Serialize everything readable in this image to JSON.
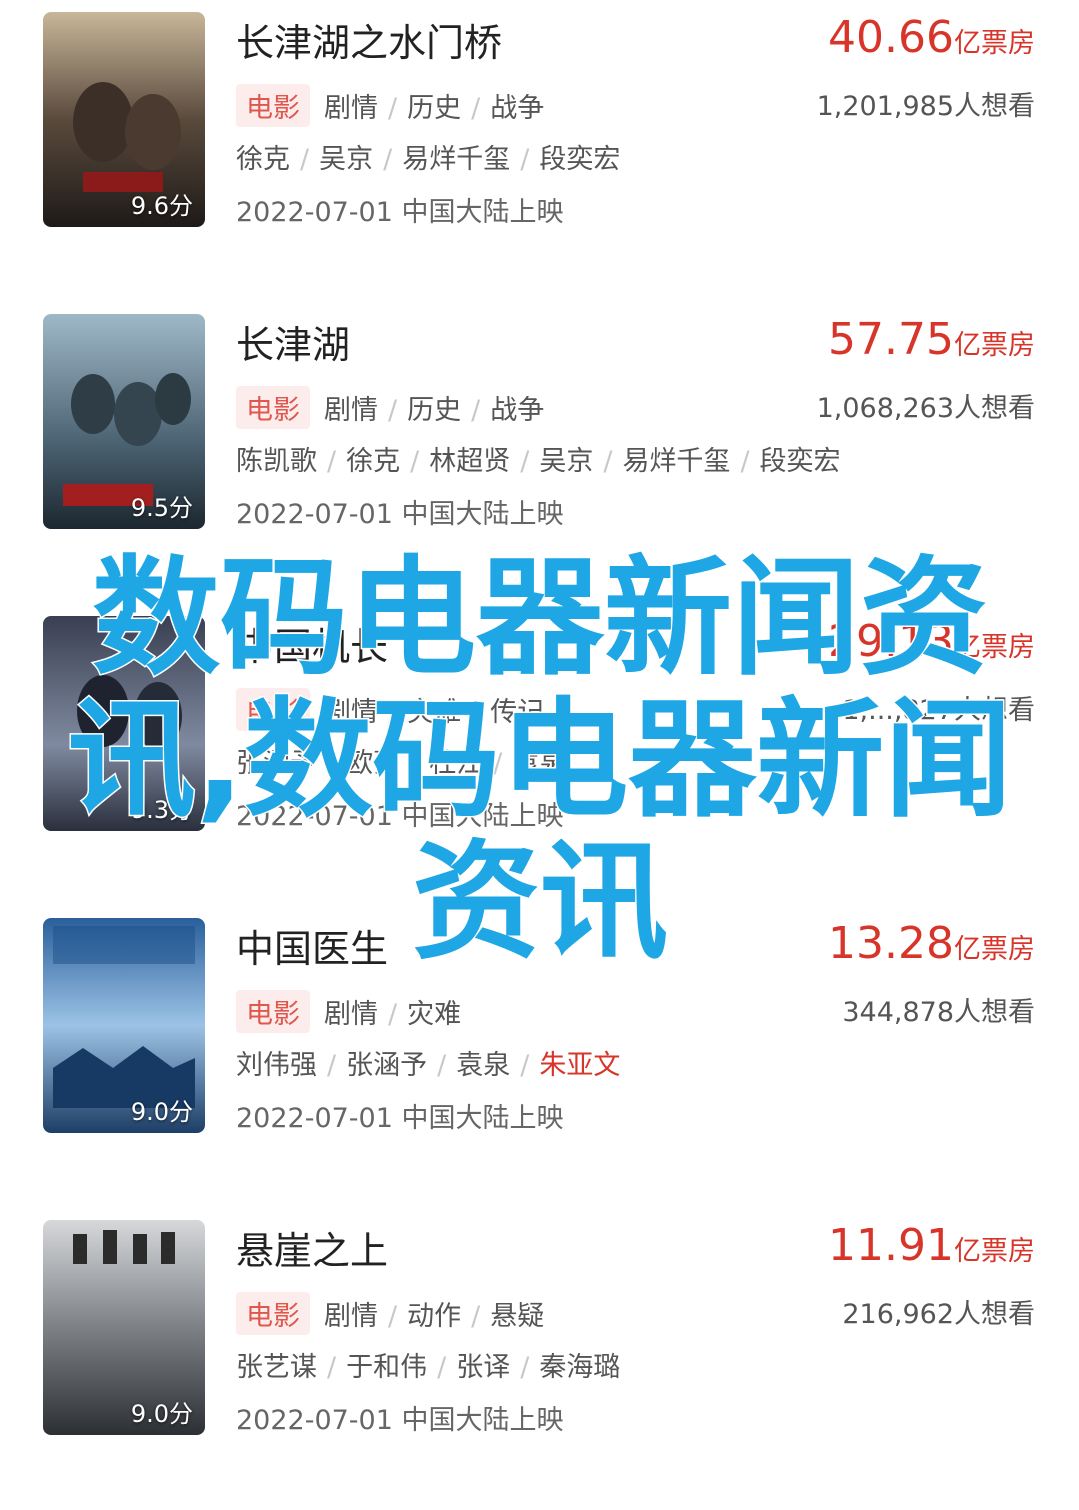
{
  "movies": [
    {
      "title": "长津湖之水门桥",
      "gross_value": "40.66",
      "gross_unit": "亿票房",
      "tag": "电影",
      "genres": [
        "剧情",
        "历史",
        "战争"
      ],
      "want": "1,201,985人想看",
      "cast": [
        "徐克",
        "吴京",
        "易烊千玺",
        "段奕宏"
      ],
      "release": "2022-07-01 中国大陆上映",
      "rating": "9.6分"
    },
    {
      "title": "长津湖",
      "gross_value": "57.75",
      "gross_unit": "亿票房",
      "tag": "电影",
      "genres": [
        "剧情",
        "历史",
        "战争"
      ],
      "want": "1,068,263人想看",
      "cast": [
        "陈凯歌",
        "徐克",
        "林超贤",
        "吴京",
        "易烊千玺",
        "段奕宏"
      ],
      "release": "2022-07-01 中国大陆上映",
      "rating": "9.5分"
    },
    {
      "title": "中国机长",
      "gross_value": "29.13",
      "gross_unit": "亿票房",
      "tag": "电影",
      "genres": [
        "剧情",
        "灾难",
        "传记"
      ],
      "want": "1,...,827人想看",
      "cast": [
        "张涵予",
        "欧豪",
        "杜江",
        "袁泉"
      ],
      "release": "2022-07-01 中国大陆上映",
      "rating": "9.3分"
    },
    {
      "title": "中国医生",
      "gross_value": "13.28",
      "gross_unit": "亿票房",
      "tag": "电影",
      "genres": [
        "剧情",
        "灾难"
      ],
      "want": "344,878人想看",
      "cast": [
        "刘伟强",
        "张涵予",
        "袁泉",
        "朱亚文"
      ],
      "release": "2022-07-01 中国大陆上映",
      "rating": "9.0分"
    },
    {
      "title": "悬崖之上",
      "gross_value": "11.91",
      "gross_unit": "亿票房",
      "tag": "电影",
      "genres": [
        "剧情",
        "动作",
        "悬疑"
      ],
      "want": "216,962人想看",
      "cast": [
        "张艺谋",
        "于和伟",
        "张译",
        "秦海璐"
      ],
      "release": "2022-07-01 中国大陆上映",
      "rating": "9.0分"
    }
  ],
  "overlay_text": "数码电器新闻资讯,数码电器新闻资讯",
  "colors": {
    "accent": "#d7352a",
    "tag_bg": "#fdecec",
    "overlay": "#1ea7e4"
  }
}
